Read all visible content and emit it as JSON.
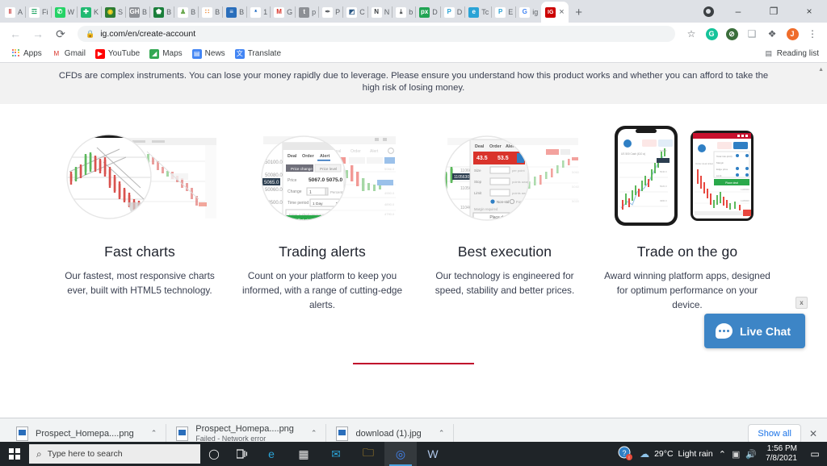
{
  "browser": {
    "tabs": [
      {
        "letter": "A",
        "icon_name": "analytics-favicon",
        "bg": "#ffffff",
        "fg": "#c62828",
        "glyph": "‖"
      },
      {
        "letter": "Fi",
        "icon_name": "filter-favicon",
        "bg": "#ffffff",
        "fg": "#1aa260",
        "glyph": "☲"
      },
      {
        "letter": "W",
        "icon_name": "whatsapp-favicon",
        "bg": "#25d366",
        "fg": "#ffffff",
        "glyph": "✆"
      },
      {
        "letter": "K",
        "icon_name": "kite-favicon",
        "bg": "#21ba72",
        "fg": "#ffffff",
        "glyph": "✚"
      },
      {
        "letter": "S",
        "icon_name": "shares-favicon",
        "bg": "#2e7d32",
        "fg": "#f9d423",
        "glyph": "◉"
      },
      {
        "letter": "B",
        "icon_name": "gh-favicon",
        "bg": "#8d9095",
        "fg": "#ffffff",
        "glyph": "GH"
      },
      {
        "letter": "B",
        "icon_name": "shield-favicon",
        "bg": "#1b7f3b",
        "fg": "#ffffff",
        "glyph": "⬟"
      },
      {
        "letter": "B",
        "icon_name": "bank-favicon",
        "bg": "#ffffff",
        "fg": "#6aa84f",
        "glyph": "♟"
      },
      {
        "letter": "B",
        "icon_name": "groups-favicon",
        "bg": "#ffffff",
        "fg": "#e8710a",
        "glyph": "∷"
      },
      {
        "letter": "B",
        "icon_name": "article-favicon",
        "bg": "#2a6ebb",
        "fg": "#ffffff",
        "glyph": "≡"
      },
      {
        "letter": "1",
        "icon_name": "chart-favicon",
        "bg": "#ffffff",
        "fg": "#1565c0",
        "glyph": "ᵜ"
      },
      {
        "letter": "G",
        "icon_name": "gmail-favicon",
        "bg": "#ffffff",
        "fg": "#d93025",
        "glyph": "M"
      },
      {
        "letter": "p",
        "icon_name": "tumblr-favicon",
        "bg": "#8d9095",
        "fg": "#ffffff",
        "glyph": "t"
      },
      {
        "letter": "P",
        "icon_name": "pen-favicon",
        "bg": "#ffffff",
        "fg": "#5f6368",
        "glyph": "✒"
      },
      {
        "letter": "C",
        "icon_name": "vk-favicon",
        "bg": "#ffffff",
        "fg": "#2a5885",
        "glyph": "◩"
      },
      {
        "letter": "N",
        "icon_name": "news-favicon",
        "bg": "#ffffff",
        "fg": "#3c4043",
        "glyph": "N"
      },
      {
        "letter": "b",
        "icon_name": "inbox-favicon",
        "bg": "#ffffff",
        "fg": "#3c4043",
        "glyph": "⤓"
      },
      {
        "letter": "D",
        "icon_name": "px-favicon",
        "bg": "#21a453",
        "fg": "#ffffff",
        "glyph": "px"
      },
      {
        "letter": "D",
        "icon_name": "paypal-favicon",
        "bg": "#ffffff",
        "fg": "#2aa3d6",
        "glyph": "P"
      },
      {
        "letter": "Tc",
        "icon_name": "edge-favicon",
        "bg": "#2aa3d6",
        "fg": "#ffffff",
        "glyph": "e"
      },
      {
        "letter": "E",
        "icon_name": "paypal2-favicon",
        "bg": "#ffffff",
        "fg": "#2aa3d6",
        "glyph": "P"
      },
      {
        "letter": "ig",
        "icon_name": "google-favicon",
        "bg": "#ffffff",
        "fg": "#4285f4",
        "glyph": "G"
      }
    ],
    "active_tab": {
      "label": "",
      "icon_name": "ig-favicon",
      "glyph": "IG",
      "bg": "#cc0000",
      "fg": "#ffffff",
      "close": "×"
    },
    "new_tab_label": "+",
    "window_controls": {
      "minimize": "–",
      "maximize": "❐",
      "close": "×"
    },
    "nav": {
      "back": "←",
      "forward": "→",
      "reload": "⟳"
    },
    "omnibox": {
      "lock_icon": "🔒",
      "url": "ig.com/en/create-account"
    },
    "toolbar_icons": [
      {
        "name": "bookmark-star-icon",
        "glyph": "☆",
        "type": "glyph",
        "color": "#5f6368"
      },
      {
        "name": "grammarly-extension-icon",
        "glyph": "G",
        "type": "circle",
        "bg": "#15c39a",
        "fg": "#ffffff"
      },
      {
        "name": "adblock-extension-icon",
        "glyph": "⊘",
        "type": "circle",
        "bg": "#3b6e3b",
        "fg": "#ffffff"
      },
      {
        "name": "clipboard-extension-icon",
        "glyph": "❑",
        "type": "glyph",
        "color": "#9aa0a6"
      },
      {
        "name": "extensions-puzzle-icon",
        "glyph": "❖",
        "type": "glyph",
        "color": "#5f6368"
      },
      {
        "name": "profile-avatar",
        "glyph": "J",
        "type": "circle",
        "bg": "#ef6c2a",
        "fg": "#ffffff"
      },
      {
        "name": "chrome-menu-icon",
        "glyph": "⋮",
        "type": "glyph",
        "color": "#5f6368"
      }
    ],
    "bookmarks": [
      {
        "label": "Apps",
        "icon_name": "apps-grid-icon",
        "type": "grid"
      },
      {
        "label": "Gmail",
        "icon_name": "gmail-icon",
        "glyph": "M",
        "bg": "#ffffff",
        "fg": "#d93025"
      },
      {
        "label": "YouTube",
        "icon_name": "youtube-icon",
        "glyph": "▶",
        "bg": "#ff0000",
        "fg": "#ffffff"
      },
      {
        "label": "Maps",
        "icon_name": "maps-icon",
        "glyph": "◢",
        "bg": "#34a853",
        "fg": "#ffffff"
      },
      {
        "label": "News",
        "icon_name": "news-icon",
        "glyph": "▤",
        "bg": "#4285f4",
        "fg": "#ffffff"
      },
      {
        "label": "Translate",
        "icon_name": "translate-icon",
        "glyph": "文",
        "bg": "#4285f4",
        "fg": "#ffffff"
      }
    ],
    "reading_list": {
      "label": "Reading list",
      "icon_name": "reading-list-icon",
      "glyph": "▤"
    }
  },
  "page": {
    "risk_warning": "CFDs are complex instruments. You can lose your money rapidly due to leverage. Please ensure you understand how this product works and whether you can afford to take the high risk of losing money.",
    "scroll_up_glyph": "▲",
    "cards": [
      {
        "title": "Fast charts",
        "body": "Our fastest, most responsive charts ever, built with HTML5 technology.",
        "art": "candlestick-chart-art"
      },
      {
        "title": "Trading alerts",
        "body": "Count on your platform to keep you informed, with a range of cutting-edge alerts.",
        "art": "alert-ticket-art"
      },
      {
        "title": "Best execution",
        "body": "Our technology is engineered for speed, stability and better prices.",
        "art": "deal-ticket-art"
      },
      {
        "title": "Trade on the go",
        "body": "Award winning platform apps, designed for optimum performance on your device.",
        "art": "mobile-phones-art"
      }
    ],
    "divider_color": "#c0002a",
    "live_chat": {
      "label": "Live Chat",
      "close_glyph": "x",
      "color": "#3d85c6"
    }
  },
  "downloads": {
    "items": [
      {
        "name": "Prospect_Homepa....png",
        "status": "",
        "caret": "⌃"
      },
      {
        "name": "Prospect_Homepa....png",
        "status": "Failed - Network error",
        "caret": "⌃"
      },
      {
        "name": "download (1).jpg",
        "status": "",
        "caret": "⌃"
      }
    ],
    "show_all_label": "Show all",
    "close_glyph": "✕"
  },
  "taskbar": {
    "search_placeholder": "Type here to search",
    "search_icon": "⌕",
    "cortana_icon": "◯",
    "taskview_icon": "☰",
    "apps": [
      {
        "name": "edge-taskbar-icon",
        "glyph": "e",
        "color": "#2aa3d6",
        "active": false
      },
      {
        "name": "microsoft-store-taskbar-icon",
        "glyph": "▦",
        "color": "#e8e8e8",
        "active": false
      },
      {
        "name": "mail-taskbar-icon",
        "glyph": "✉",
        "color": "#2aa3d6",
        "active": false
      },
      {
        "name": "file-explorer-taskbar-icon",
        "glyph": "🗀",
        "color": "#f0b429",
        "active": false
      },
      {
        "name": "chrome-taskbar-icon",
        "glyph": "◎",
        "color": "#4285f4",
        "active": true
      },
      {
        "name": "word-taskbar-icon",
        "glyph": "W",
        "color": "#aec6e8",
        "active": false
      }
    ],
    "help_icon": "?",
    "weather": {
      "temp": "29°C",
      "condition": "Light rain",
      "icon": "☁"
    },
    "tray": {
      "chevron": "⌃",
      "network_icon": "▣",
      "volume_icon": "🔊"
    },
    "time": "1:56 PM",
    "date": "7/8/2021",
    "action_center_icon": "▭"
  }
}
